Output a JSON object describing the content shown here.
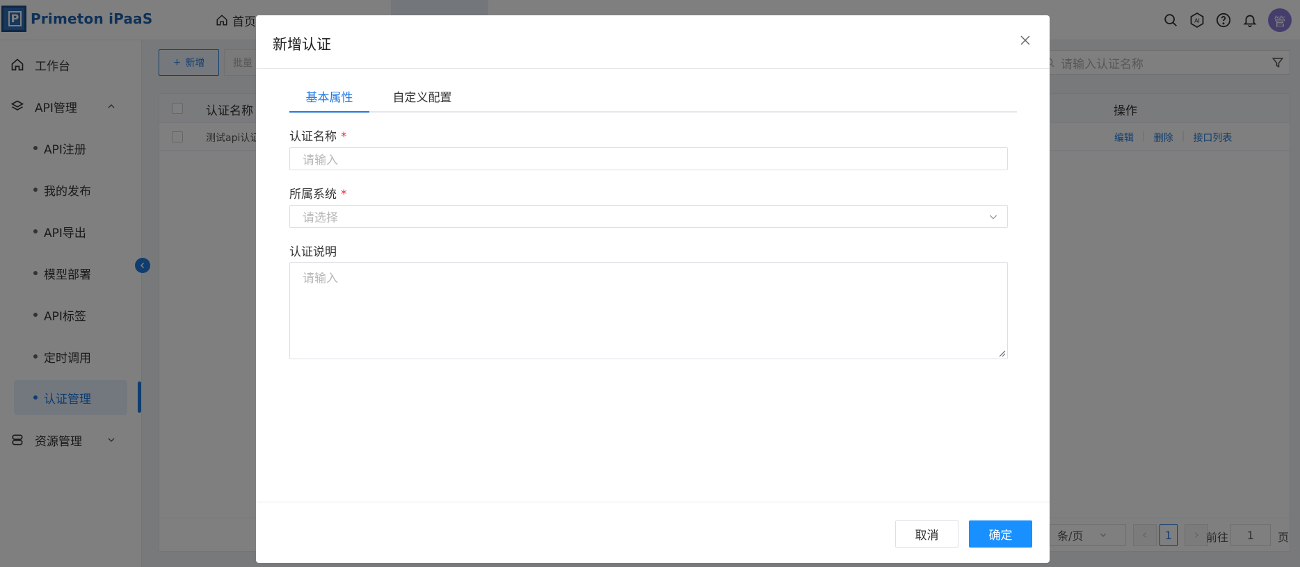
{
  "app": {
    "name": "Primeton iPaaS",
    "logo_letter": "P"
  },
  "topnav": {
    "home_label": "首页"
  },
  "header": {
    "avatar_text": "管",
    "icons": [
      "search-icon",
      "ai-icon",
      "help-icon",
      "bell-icon"
    ]
  },
  "sidebar": {
    "items": [
      {
        "label": "工作台",
        "icon": "home-icon"
      },
      {
        "label": "API管理",
        "icon": "layers-icon"
      },
      {
        "label": "资源管理",
        "icon": "database-icon"
      }
    ],
    "sub_items": [
      {
        "label": "API注册"
      },
      {
        "label": "我的发布"
      },
      {
        "label": "API导出"
      },
      {
        "label": "模型部署"
      },
      {
        "label": "API标签"
      },
      {
        "label": "定时调用"
      },
      {
        "label": "认证管理"
      }
    ]
  },
  "toolbar": {
    "add_label": "新增",
    "batch_label": "批量",
    "search_placeholder": "请输入认证名称"
  },
  "table": {
    "headers": {
      "name": "认证名称",
      "operation": "操作"
    },
    "rows": [
      {
        "name": "测试api认证"
      }
    ],
    "row_actions": [
      "编辑",
      "删除",
      "接口列表"
    ]
  },
  "pagination": {
    "page_size_label": "条/页",
    "current_page": "1",
    "goto_label": "前往",
    "goto_value": "1",
    "page_unit": "页"
  },
  "modal": {
    "title": "新增认证",
    "tabs": [
      {
        "label": "基本属性"
      },
      {
        "label": "自定义配置"
      }
    ],
    "fields": {
      "name": {
        "label": "认证名称",
        "required_mark": "*",
        "placeholder": "请输入"
      },
      "system": {
        "label": "所属系统",
        "required_mark": "*",
        "placeholder": "请选择"
      },
      "description": {
        "label": "认证说明",
        "placeholder": "请输入"
      }
    },
    "cancel_label": "取消",
    "ok_label": "确定"
  },
  "colors": {
    "primary": "#1f7ae0",
    "ok_button": "#1890ff",
    "required": "#f5222d",
    "overlay": "rgba(0,0,0,0.5)"
  }
}
